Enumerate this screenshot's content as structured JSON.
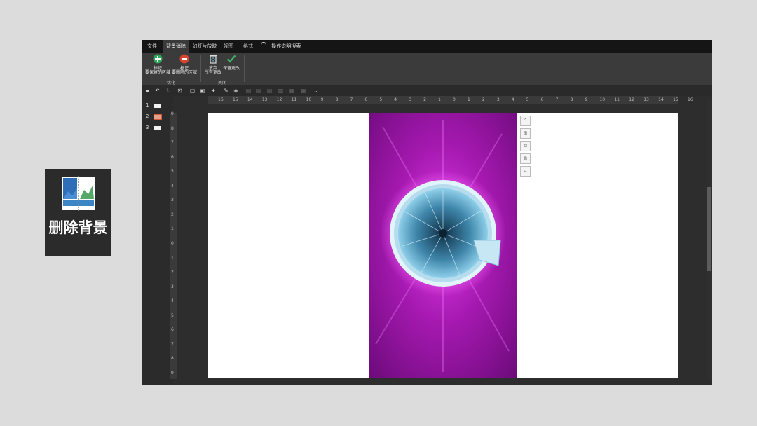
{
  "feature_card": {
    "label": "删除背景",
    "icon": "remove-background-icon"
  },
  "window": {
    "tabs": [
      {
        "label": "文件"
      },
      {
        "label": "背景消除"
      },
      {
        "label": "幻灯片放映"
      },
      {
        "label": "视图"
      },
      {
        "label": "格式"
      }
    ],
    "search_label": "操作说明搜索",
    "ribbon": {
      "mark_keep": {
        "line1": "标记",
        "line2": "要保留的区域"
      },
      "mark_remove": {
        "line1": "标记",
        "line2": "要删除的区域"
      },
      "group_optimize": "优化",
      "discard": {
        "line1": "放弃",
        "line2": "所有更改"
      },
      "keep_changes": {
        "line1": "保留更改"
      },
      "group_close": "关闭"
    },
    "slides": [
      {
        "number": "1"
      },
      {
        "number": "2"
      },
      {
        "number": "3"
      }
    ],
    "ruler_h": [
      "16",
      "15",
      "14",
      "13",
      "12",
      "11",
      "10",
      "9",
      "8",
      "7",
      "6",
      "5",
      "4",
      "3",
      "2",
      "1",
      "0",
      "1",
      "2",
      "3",
      "4",
      "5",
      "6",
      "7",
      "8",
      "9",
      "10",
      "11",
      "12",
      "13",
      "14",
      "15",
      "16"
    ],
    "ruler_v": [
      "9",
      "8",
      "7",
      "6",
      "5",
      "4",
      "3",
      "2",
      "1",
      "0",
      "1",
      "2",
      "3",
      "4",
      "5",
      "6",
      "7",
      "8",
      "9"
    ]
  },
  "colors": {
    "accent_tab": "#3a3a3a",
    "image_purple": "#a018a8",
    "ring_glow": "#ff3cff"
  }
}
